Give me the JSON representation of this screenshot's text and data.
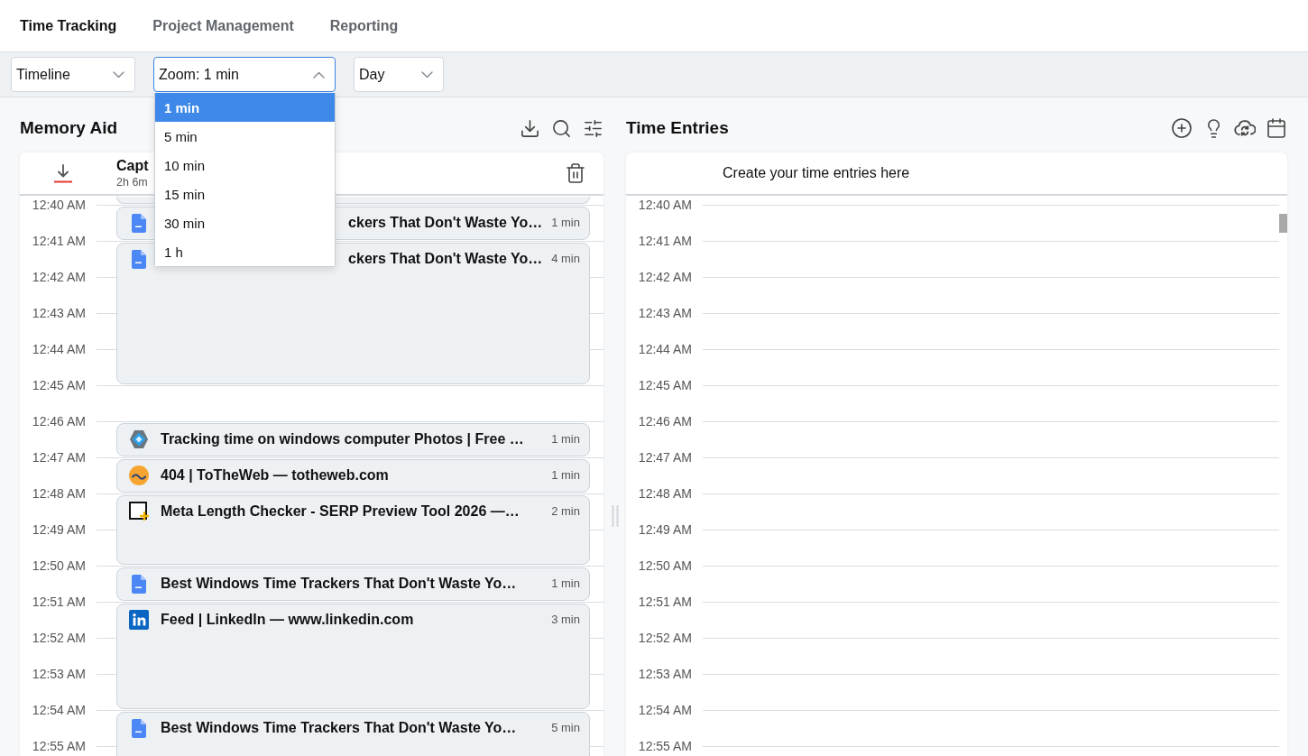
{
  "tabs": [
    {
      "label": "Time Tracking",
      "selected": true
    },
    {
      "label": "Project Management",
      "selected": false
    },
    {
      "label": "Reporting",
      "selected": false
    }
  ],
  "toolbar": {
    "selects": [
      {
        "value": "Timeline",
        "open": false
      },
      {
        "value": "Zoom: 1 min",
        "open": true,
        "options": [
          {
            "label": "1 min",
            "selected": true
          },
          {
            "label": "5 min",
            "selected": false
          },
          {
            "label": "10 min",
            "selected": false
          },
          {
            "label": "15 min",
            "selected": false
          },
          {
            "label": "30 min",
            "selected": false
          },
          {
            "label": "1 h",
            "selected": false
          }
        ]
      },
      {
        "value": "Day",
        "open": false
      }
    ]
  },
  "memory_aid": {
    "title": "Memory Aid",
    "captures": {
      "title": "Capt",
      "subtitle": "2h 6m"
    },
    "top_entry_cut_off": true,
    "slots": [
      {
        "time": "12:40 AM",
        "entry": {
          "kind": "doc",
          "title": "ckers That Don't Waste Yo…",
          "duration": "1 min",
          "start_hidden_by_menu": true
        }
      },
      {
        "time": "12:41 AM",
        "entry": {
          "kind": "doc",
          "title": "ckers That Don't Waste Yo…",
          "duration": "4 min",
          "start_hidden_by_menu": true
        }
      },
      {
        "time": "12:42 AM"
      },
      {
        "time": "12:43 AM"
      },
      {
        "time": "12:44 AM"
      },
      {
        "time": "12:45 AM"
      },
      {
        "time": "12:46 AM",
        "entry": {
          "kind": "diamond",
          "title": "Tracking time on windows computer Photos | Free …",
          "duration": "1 min",
          "start_hidden_by_menu": false
        }
      },
      {
        "time": "12:47 AM",
        "entry": {
          "kind": "round_logo",
          "title": "404 | ToTheWeb — totheweb.com",
          "duration": "1 min",
          "start_hidden_by_menu": false
        }
      },
      {
        "time": "12:48 AM",
        "entry": {
          "kind": "square_plus",
          "title": "Meta Length Checker - SERP Preview Tool 2026 —…",
          "duration": "2 min",
          "start_hidden_by_menu": false
        }
      },
      {
        "time": "12:49 AM"
      },
      {
        "time": "12:50 AM",
        "entry": {
          "kind": "doc",
          "title": "Best Windows Time Trackers That Don't Waste Yo…",
          "duration": "1 min",
          "start_hidden_by_menu": false
        }
      },
      {
        "time": "12:51 AM",
        "entry": {
          "kind": "in_logo",
          "title": "Feed | LinkedIn — www.linkedin.com",
          "duration": "3 min",
          "start_hidden_by_menu": false
        }
      },
      {
        "time": "12:52 AM"
      },
      {
        "time": "12:53 AM"
      },
      {
        "time": "12:54 AM",
        "entry": {
          "kind": "doc",
          "title": "Best Windows Time Trackers That Don't Waste Yo…",
          "duration": "5 min",
          "start_hidden_by_menu": false
        }
      },
      {
        "time": "12:55 AM"
      }
    ]
  },
  "time_entries": {
    "title": "Time Entries",
    "header_text": "Create your time entries here",
    "slots": [
      {
        "time": "12:40 AM"
      },
      {
        "time": "12:41 AM"
      },
      {
        "time": "12:42 AM"
      },
      {
        "time": "12:43 AM"
      },
      {
        "time": "12:44 AM"
      },
      {
        "time": "12:45 AM"
      },
      {
        "time": "12:46 AM"
      },
      {
        "time": "12:47 AM"
      },
      {
        "time": "12:48 AM"
      },
      {
        "time": "12:49 AM"
      },
      {
        "time": "12:50 AM"
      },
      {
        "time": "12:51 AM"
      },
      {
        "time": "12:52 AM"
      },
      {
        "time": "12:53 AM"
      },
      {
        "time": "12:54 AM"
      },
      {
        "time": "12:55 AM"
      }
    ]
  }
}
